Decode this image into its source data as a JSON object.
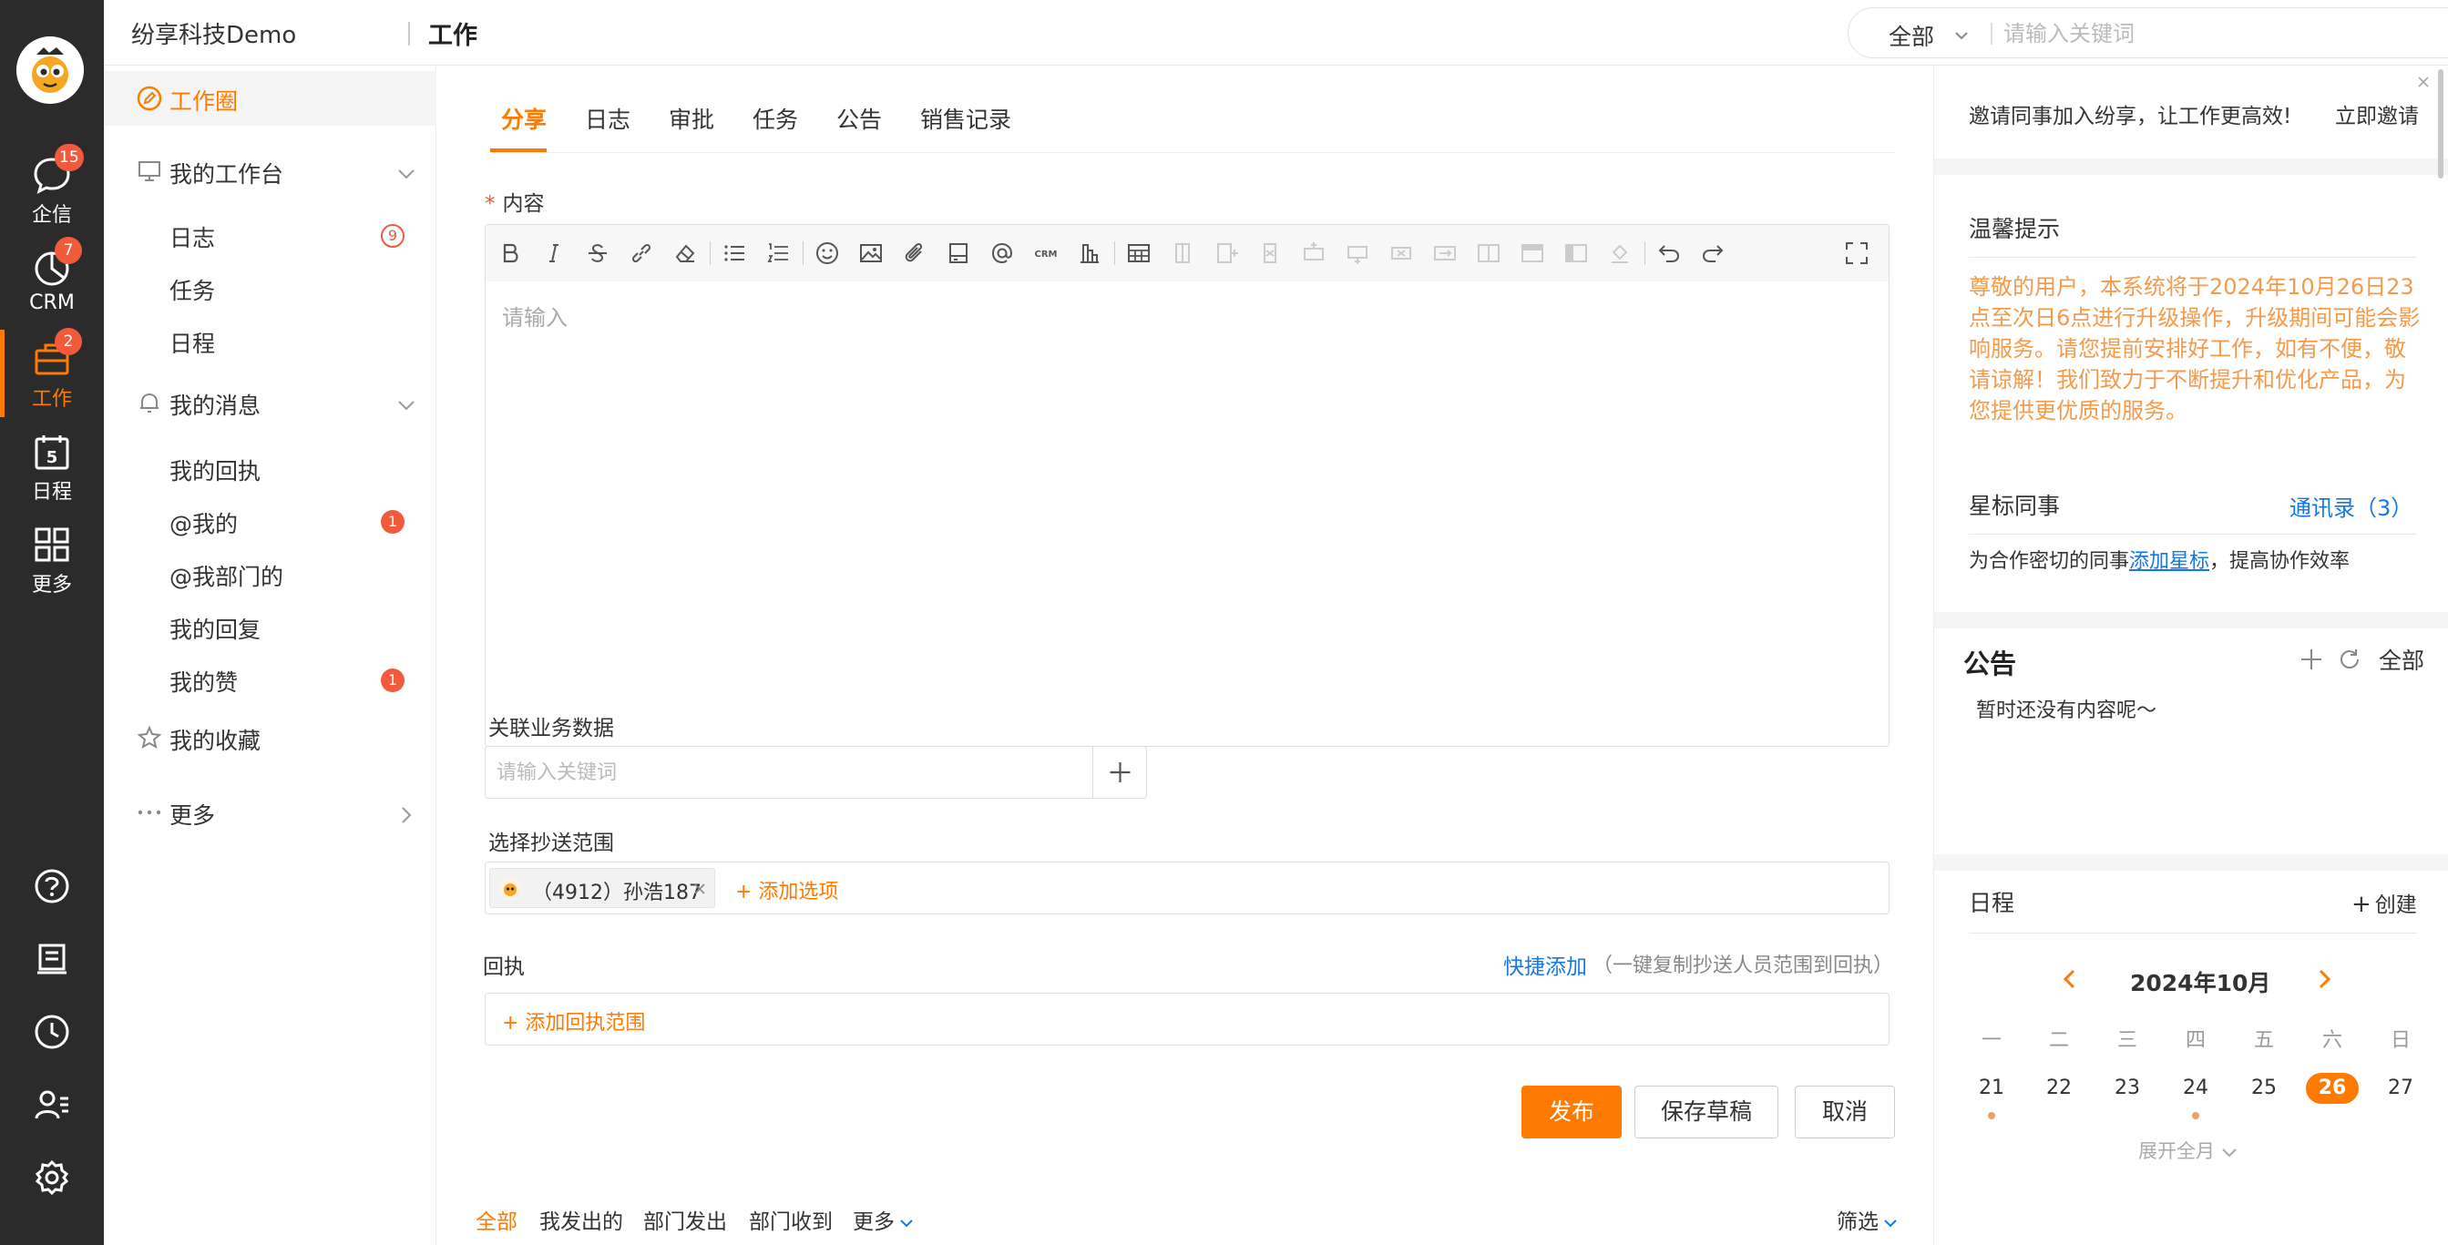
{
  "rail": {
    "items": [
      {
        "label": "企信",
        "badge": "15"
      },
      {
        "label": "CRM",
        "badge": "7"
      },
      {
        "label": "工作",
        "badge": "2"
      },
      {
        "label": "日程",
        "badge": ""
      },
      {
        "label": "更多",
        "badge": ""
      }
    ],
    "calendar_icon_day": "5"
  },
  "topbar": {
    "company": "纷享科技Demo",
    "title": "工作",
    "search_scope": "全部",
    "search_placeholder": "请输入关键词"
  },
  "nav": {
    "work_circle": "工作圈",
    "my_workbench": "我的工作台",
    "workbench_items": [
      {
        "label": "日志",
        "badge": "9"
      },
      {
        "label": "任务",
        "badge": ""
      },
      {
        "label": "日程",
        "badge": ""
      }
    ],
    "my_messages": "我的消息",
    "message_items": [
      {
        "label": "我的回执",
        "badge": ""
      },
      {
        "label": "@我的",
        "badge": "1"
      },
      {
        "label": "@我部门的",
        "badge": ""
      },
      {
        "label": "我的回复",
        "badge": ""
      },
      {
        "label": "我的赞",
        "badge": "1"
      }
    ],
    "favorites": "我的收藏",
    "more": "更多"
  },
  "main": {
    "tabs": [
      "分享",
      "日志",
      "审批",
      "任务",
      "公告",
      "销售记录"
    ],
    "content_label": "内容",
    "content_required": "*",
    "editor_placeholder": "请输入",
    "biz_label": "关联业务数据",
    "biz_placeholder": "请输入关键词",
    "cc_label": "选择抄送范围",
    "cc_chip": "（4912）孙浩187",
    "cc_add": "+ 添加选项",
    "receipt_label": "回执",
    "quick_add": "快捷添加",
    "quick_add_hint": "（一键复制抄送人员范围到回执）",
    "receipt_add": "+ 添加回执范围",
    "btn_publish": "发布",
    "btn_draft": "保存草稿",
    "btn_cancel": "取消",
    "filters": [
      "全部",
      "我发出的",
      "部门发出",
      "部门收到",
      "更多"
    ],
    "filter_btn": "筛选"
  },
  "right": {
    "invite_text": "邀请同事加入纷享，让工作更高效!",
    "invite_link": "立即邀请",
    "tips_title": "温馨提示",
    "tips_notice": "尊敬的用户，本系统将于2024年10月26日23点至次日6点进行升级操作，升级期间可能会影响服务。请您提前安排好工作，如有不便，敬请谅解！我们致力于不断提升和优化产品，为您提供更优质的服务。",
    "star_title": "星标同事",
    "star_contacts": "通讯录",
    "star_count": "（3）",
    "star_text_pre": "为合作密切的同事",
    "star_text_link": "添加星标",
    "star_text_post": "，提高协作效率",
    "ann_title": "公告",
    "ann_all": "全部",
    "ann_empty": "暂时还没有内容呢～",
    "schedule_title": "日程",
    "schedule_create": "创建",
    "calendar": {
      "month": "2024年10月",
      "weekdays": [
        "一",
        "二",
        "三",
        "四",
        "五",
        "六",
        "日"
      ],
      "days": [
        "21",
        "22",
        "23",
        "24",
        "25",
        "26",
        "27"
      ],
      "today_index": 5,
      "dot_indices": [
        0,
        3
      ],
      "expand": "展开全月"
    }
  },
  "colors": {
    "accent": "#ff7a00",
    "link": "#1677e6",
    "badge": "#f25a3c",
    "rail_bg": "#2b2b2b"
  }
}
